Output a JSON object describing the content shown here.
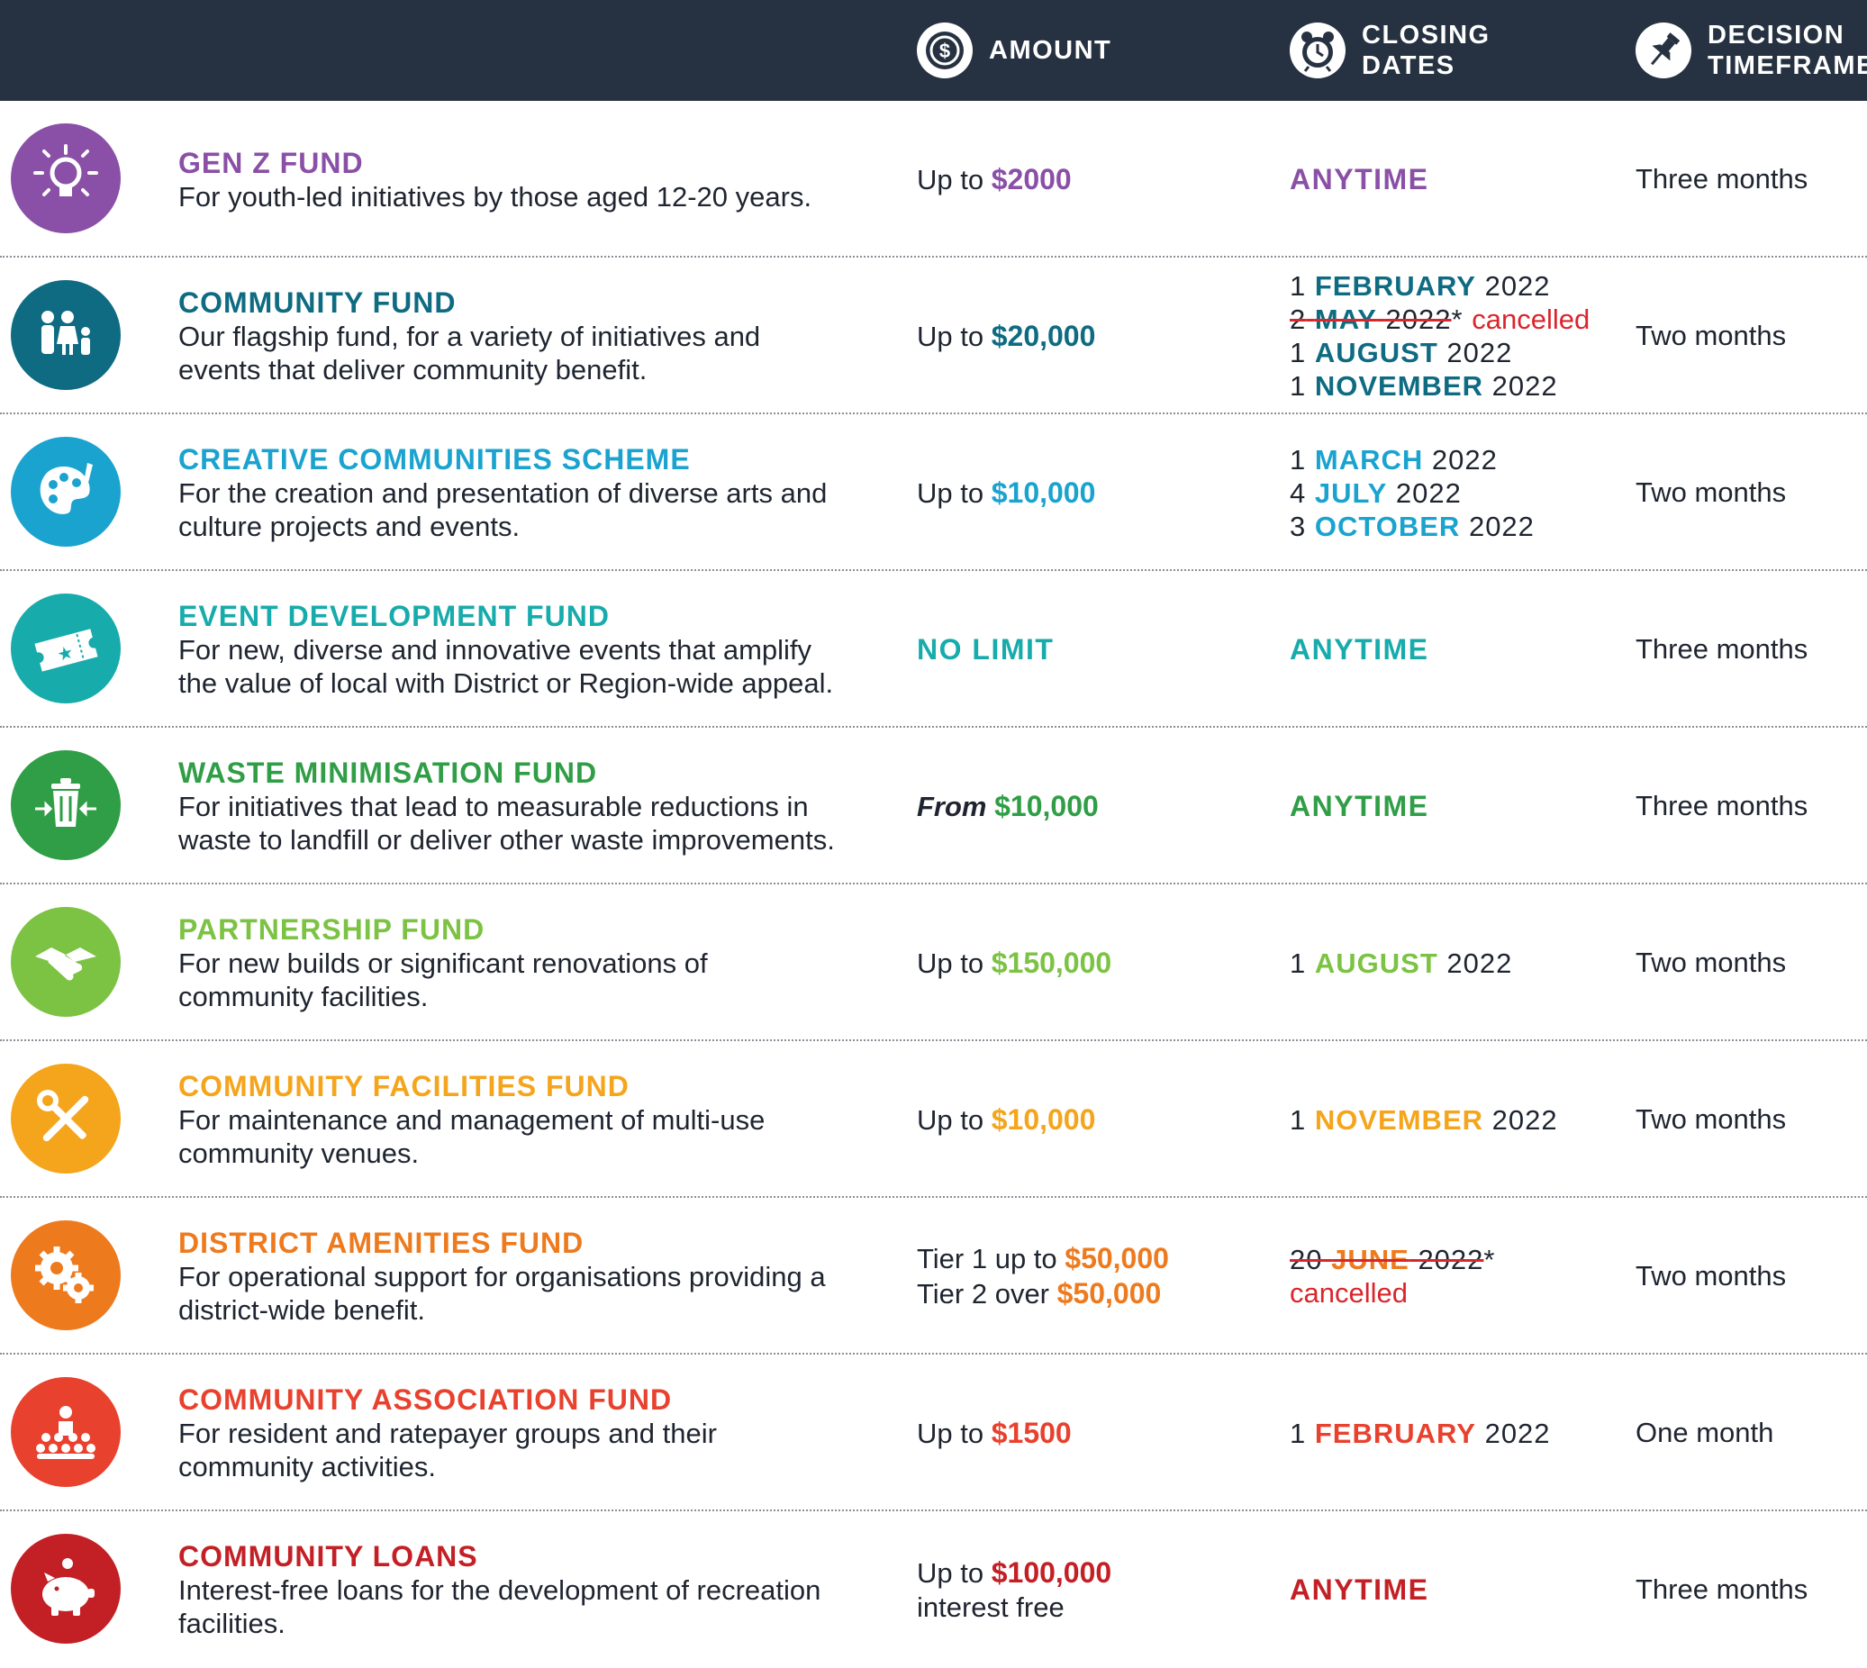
{
  "header": {
    "amount_label": "AMOUNT",
    "closing_label_1": "CLOSING",
    "closing_label_2": "DATES",
    "decision_label_1": "DECISION",
    "decision_label_2": "TIMEFRAME",
    "amount_icon": "dollar-icon",
    "closing_icon": "alarm-clock-icon",
    "decision_icon": "pushpin-icon"
  },
  "rows": [
    {
      "color": "#8a4fa6",
      "icon": "lightbulb-icon",
      "name": "GEN Z FUND",
      "desc": "For youth-led initiatives by those aged 12-20 years.",
      "amount_prefix": "Up to ",
      "amount_value": "$2000",
      "closing_anytime": "ANYTIME",
      "decision": "Three months"
    },
    {
      "color": "#0e6b82",
      "icon": "family-icon",
      "name": "COMMUNITY FUND",
      "desc": "Our flagship fund, for a variety of initiatives and events that deliver community benefit.",
      "amount_prefix": "Up to ",
      "amount_value": "$20,000",
      "closing": [
        {
          "day": "1",
          "month": "FEBRUARY",
          "year": "2022"
        },
        {
          "day": "2",
          "month": "MAY",
          "year": "2022",
          "mark": "*",
          "note": "cancelled"
        },
        {
          "day": "1",
          "month": "AUGUST",
          "year": "2022"
        },
        {
          "day": "1",
          "month": "NOVEMBER",
          "year": "2022"
        }
      ],
      "decision": "Two months"
    },
    {
      "color": "#1aa3cf",
      "icon": "palette-icon",
      "name": "CREATIVE COMMUNITIES SCHEME",
      "desc": "For the creation and presentation of diverse arts and culture projects and events.",
      "amount_prefix": "Up to ",
      "amount_value": "$10,000",
      "closing": [
        {
          "day": "1",
          "month": "MARCH",
          "year": "2022"
        },
        {
          "day": "4",
          "month": "JULY",
          "year": "2022"
        },
        {
          "day": "3",
          "month": "OCTOBER",
          "year": "2022"
        }
      ],
      "decision": "Two months"
    },
    {
      "color": "#17abab",
      "icon": "ticket-icon",
      "name": "EVENT DEVELOPMENT FUND",
      "desc": "For new, diverse and innovative events that amplify the value of local with District or Region-wide appeal.",
      "amount_limit": "NO LIMIT",
      "closing_anytime": "ANYTIME",
      "decision": "Three months"
    },
    {
      "color": "#2f9e46",
      "icon": "trash-bin-icon",
      "name": "WASTE MINIMISATION FUND",
      "desc": "For initiatives that lead to measurable reductions in waste to landfill or deliver other waste improvements.",
      "amount_from": "From ",
      "amount_value": "$10,000",
      "closing_anytime": "ANYTIME",
      "decision": "Three months"
    },
    {
      "color": "#7cc243",
      "icon": "handshake-icon",
      "name": "PARTNERSHIP FUND",
      "desc": "For new builds or significant renovations of community facilities.",
      "amount_prefix": "Up to ",
      "amount_value": "$150,000",
      "closing": [
        {
          "day": "1",
          "month": "AUGUST",
          "year": "2022"
        }
      ],
      "decision": "Two months"
    },
    {
      "color": "#f5a51c",
      "icon": "tools-icon",
      "name": "COMMUNITY FACILITIES FUND",
      "desc": "For maintenance and management of multi-use community venues.",
      "amount_prefix": "Up to ",
      "amount_value": "$10,000",
      "closing": [
        {
          "day": "1",
          "month": "NOVEMBER",
          "year": "2022"
        }
      ],
      "decision": "Two months"
    },
    {
      "color": "#ee7a1e",
      "icon": "gears-icon",
      "name": "DISTRICT AMENITIES FUND",
      "desc": "For operational support for organisations providing a district-wide benefit.",
      "tiers": [
        {
          "prefix": "Tier 1 up to ",
          "value": "$50,000"
        },
        {
          "prefix": "Tier 2 over ",
          "value": "$50,000"
        }
      ],
      "closing": [
        {
          "day": "20",
          "month": "JUNE",
          "year": "2022",
          "mark": "*",
          "note": "cancelled",
          "note_newline": true
        }
      ],
      "decision": "Two months"
    },
    {
      "color": "#e8412e",
      "icon": "community-group-icon",
      "name": "COMMUNITY ASSOCIATION FUND",
      "desc": "For resident and ratepayer groups and their community activities.",
      "amount_prefix": "Up to ",
      "amount_value": "$1500",
      "closing": [
        {
          "day": "1",
          "month": "FEBRUARY",
          "year": "2022"
        }
      ],
      "decision": "One month"
    },
    {
      "color": "#c32026",
      "icon": "piggy-bank-icon",
      "name": "COMMUNITY LOANS",
      "desc": "Interest-free loans for the development of recreation facilities.",
      "amount_prefix": "Up to ",
      "amount_value": "$100,000",
      "amount_suffix": "interest free",
      "closing_anytime": "ANYTIME",
      "decision": "Three months"
    }
  ]
}
